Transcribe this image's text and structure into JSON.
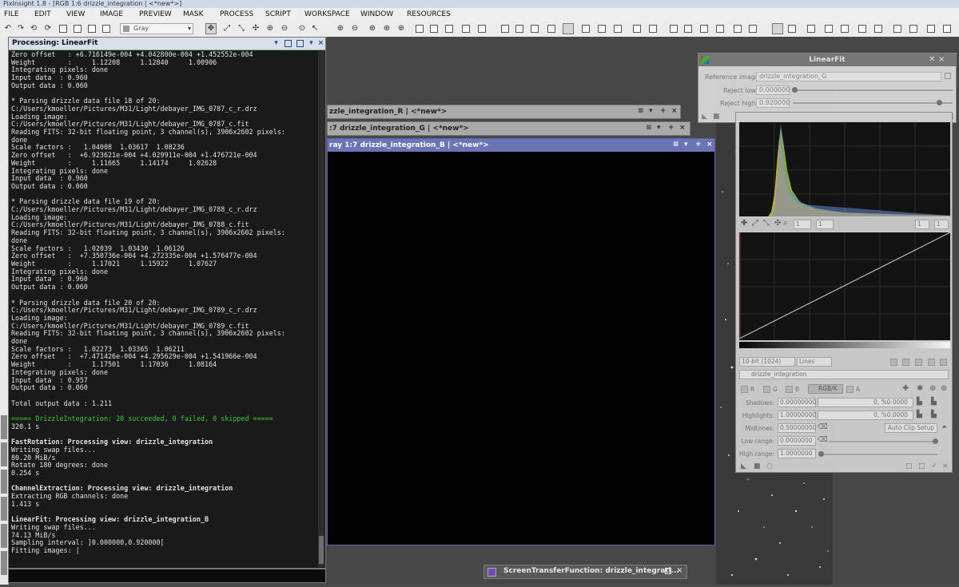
{
  "window": {
    "title": "PixInsight 1.8 - [RGB 1:6 drizzle_integration | <*new*>]"
  },
  "menu": [
    "FILE",
    "EDIT",
    "VIEW",
    "IMAGE",
    "PREVIEW",
    "MASK",
    "PROCESS",
    "SCRIPT",
    "WORKSPACE",
    "WINDOW",
    "RESOURCES"
  ],
  "toolbar": {
    "color_space": "Gray"
  },
  "console": {
    "title": "Processing: LinearFit",
    "lines": [
      {
        "t": "Zero offset   : +6.716149e-004 +4.042800e-004 +1.452552e-004",
        "s": ""
      },
      {
        "t": "Weight        :     1.12208     1.12840     1.00906",
        "s": ""
      },
      {
        "t": "Integrating pixels: done",
        "s": ""
      },
      {
        "t": "Input data  : 0.960",
        "s": ""
      },
      {
        "t": "Output data : 0.060",
        "s": ""
      },
      {
        "t": "",
        "s": ""
      },
      {
        "t": "* Parsing drizzle data file 18 of 20:",
        "s": ""
      },
      {
        "t": "C:/Users/kmoeller/Pictures/M31/Light/debayer_IMG_0787_c_r.drz",
        "s": ""
      },
      {
        "t": "Loading image:",
        "s": ""
      },
      {
        "t": "C:/Users/kmoeller/Pictures/M31/Light/debayer_IMG_0787_c.fit",
        "s": ""
      },
      {
        "t": "Reading FITS: 32-bit floating point, 3 channel(s), 3906x2602 pixels:",
        "s": ""
      },
      {
        "t": "done",
        "s": ""
      },
      {
        "t": "Scale factors :   1.04008  1.03617  1.08236",
        "s": ""
      },
      {
        "t": "Zero offset   :  +6.923621e-004 +4.029911e-004 +1.476721e-004",
        "s": ""
      },
      {
        "t": "Weight        :     1.11665     1.14174     1.02628",
        "s": ""
      },
      {
        "t": "Integrating pixels: done",
        "s": ""
      },
      {
        "t": "Input data  : 0.960",
        "s": ""
      },
      {
        "t": "Output data : 0.060",
        "s": ""
      },
      {
        "t": "",
        "s": ""
      },
      {
        "t": "* Parsing drizzle data file 19 of 20:",
        "s": ""
      },
      {
        "t": "C:/Users/kmoeller/Pictures/M31/Light/debayer_IMG_0788_c_r.drz",
        "s": ""
      },
      {
        "t": "Loading image:",
        "s": ""
      },
      {
        "t": "C:/Users/kmoeller/Pictures/M31/Light/debayer_IMG_0788_c.fit",
        "s": ""
      },
      {
        "t": "Reading FITS: 32-bit floating point, 3 channel(s), 3906x2602 pixels:",
        "s": ""
      },
      {
        "t": "done",
        "s": ""
      },
      {
        "t": "Scale factors :   1.02039  1.03430  1.06126",
        "s": ""
      },
      {
        "t": "Zero offset   :  +7.350736e-004 +4.272335e-004 +1.576477e-004",
        "s": ""
      },
      {
        "t": "Weight        :     1.17021     1.15922     1.07627",
        "s": ""
      },
      {
        "t": "Integrating pixels: done",
        "s": ""
      },
      {
        "t": "Input data  : 0.960",
        "s": ""
      },
      {
        "t": "Output data : 0.060",
        "s": ""
      },
      {
        "t": "",
        "s": ""
      },
      {
        "t": "* Parsing drizzle data file 20 of 20:",
        "s": ""
      },
      {
        "t": "C:/Users/kmoeller/Pictures/M31/Light/debayer_IMG_0789_c_r.drz",
        "s": ""
      },
      {
        "t": "Loading image:",
        "s": ""
      },
      {
        "t": "C:/Users/kmoeller/Pictures/M31/Light/debayer_IMG_0789_c.fit",
        "s": ""
      },
      {
        "t": "Reading FITS: 32-bit floating point, 3 channel(s), 3906x2602 pixels:",
        "s": ""
      },
      {
        "t": "done",
        "s": ""
      },
      {
        "t": "Scale factors :   1.02273  1.03365  1.06211",
        "s": ""
      },
      {
        "t": "Zero offset   :  +7.471426e-004 +4.295629e-004 +1.541966e-004",
        "s": ""
      },
      {
        "t": "Weight        :     1.17501     1.17036     1.08164",
        "s": ""
      },
      {
        "t": "Integrating pixels: done",
        "s": ""
      },
      {
        "t": "Input data  : 0.957",
        "s": ""
      },
      {
        "t": "Output data : 0.060",
        "s": ""
      },
      {
        "t": "",
        "s": ""
      },
      {
        "t": "Total output data : 1.211",
        "s": ""
      },
      {
        "t": "",
        "s": ""
      },
      {
        "t": "===== DrizzleIntegration: 20 succeeded, 0 failed, 0 skipped =====",
        "s": "green"
      },
      {
        "t": "320.1 s",
        "s": ""
      },
      {
        "t": "",
        "s": ""
      },
      {
        "t": "FastRotation: Processing view: drizzle_integration",
        "s": "bold"
      },
      {
        "t": "Writing swap files...",
        "s": ""
      },
      {
        "t": "80.20 MiB/s",
        "s": ""
      },
      {
        "t": "Rotate 180 degrees: done",
        "s": ""
      },
      {
        "t": "0.254 s",
        "s": ""
      },
      {
        "t": "",
        "s": ""
      },
      {
        "t": "ChannelExtraction: Processing view: drizzle_integration",
        "s": "bold"
      },
      {
        "t": "Extracting RGB channels: done",
        "s": ""
      },
      {
        "t": "1.413 s",
        "s": ""
      },
      {
        "t": "",
        "s": ""
      },
      {
        "t": "LinearFit: Processing view: drizzle_integration_B",
        "s": "bold"
      },
      {
        "t": "Writing swap files...",
        "s": ""
      },
      {
        "t": "74.13 MiB/s",
        "s": ""
      },
      {
        "t": "Sampling interval: ]0.000000,0.920000[",
        "s": ""
      },
      {
        "t": "Fitting images: |",
        "s": ""
      }
    ]
  },
  "image_windows": [
    {
      "title": "zzle_integration_R | <*new*>"
    },
    {
      "title": ":7 drizzle_integration_G | <*new*>"
    },
    {
      "title": "ray 1:7 drizzle_integration_B | <*new*>"
    }
  ],
  "linearfit": {
    "title": "LinearFit",
    "reference_label": "Reference image:",
    "reference_value": "drizzle_integration_G",
    "reject_low_label": "Reject low:",
    "reject_low_value": "0.000000",
    "reject_high_label": "Reject high:",
    "reject_high_value": "0.920000"
  },
  "histogram": {
    "spin1": "1",
    "spin2": "1",
    "spin3": "1",
    "spin4": "1",
    "resolution": "10-bit (1024)",
    "mode": "Lines",
    "view": "drizzle_integration",
    "channels": {
      "r": "R",
      "g": "G",
      "b": "B",
      "rgbk": "RGB/K",
      "a": "A"
    },
    "shadows_label": "Shadows:",
    "shadows_value": "0.00000000",
    "shadows_info": "0, %0.0000",
    "highlights_label": "Highlights:",
    "highlights_value": "1.00000000",
    "highlights_info": "0, %0.0000",
    "midtones_label": "Midtones:",
    "midtones_value": "0.50000000",
    "auto_clip": "Auto Clip Setup",
    "low_range_label": "Low range:",
    "low_range_value": "0.0000000",
    "high_range_label": "High range:",
    "high_range_value": "1.0000000"
  },
  "stf": {
    "title": "ScreenTransferFunction: drizzle_integrati..."
  }
}
